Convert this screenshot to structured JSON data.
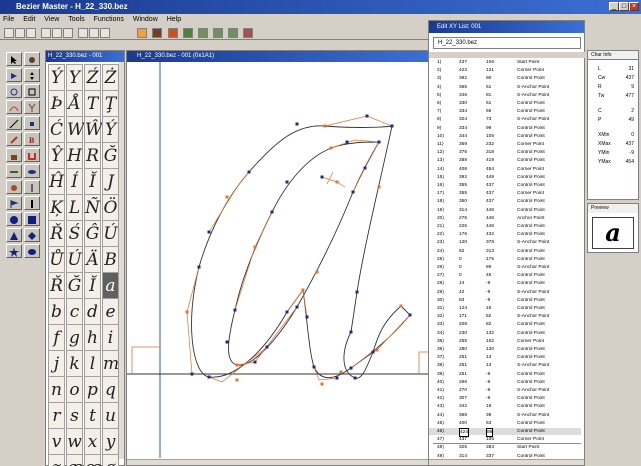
{
  "app": {
    "title": "Bezier Master - H_22_330.bez"
  },
  "menu": [
    "File",
    "Edit",
    "View",
    "Tools",
    "Functions",
    "Window",
    "Help"
  ],
  "glyph_window": {
    "title": "H_22_330.bez - 001"
  },
  "canvas_window": {
    "title": "H_22_330.bez - 001 (0x1A1)"
  },
  "glyphs": [
    "Ý",
    "Y",
    "Ź",
    "Ż",
    "Þ",
    "Å",
    "T",
    "Ţ",
    "Ć",
    "W",
    "Ŵ",
    "Ý",
    "Ŷ",
    "H",
    "R",
    "Ğ",
    "Ĥ",
    "Í",
    "Ĭ",
    "J",
    "Ķ",
    "L",
    "Ñ",
    "Ö",
    "Ř",
    "Ś",
    "Ĝ",
    "Ú",
    "Ů",
    "Ú",
    "Ä",
    "B",
    "Ř",
    "Ğ",
    "Ĭ",
    "a",
    "b",
    "c",
    "d",
    "e",
    "f",
    "g",
    "h",
    "i",
    "j",
    "k",
    "l",
    "m",
    "n",
    "o",
    "p",
    "q",
    "r",
    "s",
    "t",
    "u",
    "v",
    "w",
    "x",
    "y",
    "z",
    "æ",
    "œ",
    "ø"
  ],
  "point_list": {
    "title": "Edit XY List: 001",
    "file": "H_22_330.bez",
    "rows": [
      {
        "n": "1)",
        "x": "437",
        "y": "106",
        "t": "Start Point"
      },
      {
        "n": "2)",
        "x": "423",
        "y": "121",
        "t": "Corner Point"
      },
      {
        "n": "3)",
        "x": "392",
        "y": "90",
        "t": "Control Point"
      },
      {
        "n": "4)",
        "x": "365",
        "y": "61",
        "t": "S-Anchor Point"
      },
      {
        "n": "5)",
        "x": "346",
        "y": "81",
        "t": "S-Anchor Point"
      },
      {
        "n": "6)",
        "x": "330",
        "y": "61",
        "t": "Control Point"
      },
      {
        "n": "7)",
        "x": "334",
        "y": "66",
        "t": "Control Point"
      },
      {
        "n": "8)",
        "x": "324",
        "y": "73",
        "t": "S-Anchor Point"
      },
      {
        "n": "9)",
        "x": "334",
        "y": "99",
        "t": "Control Point"
      },
      {
        "n": "10)",
        "x": "344",
        "y": "105",
        "t": "Control Point"
      },
      {
        "n": "11)",
        "x": "359",
        "y": "232",
        "t": "Corner Point"
      },
      {
        "n": "12)",
        "x": "376",
        "y": "318",
        "t": "Control Point"
      },
      {
        "n": "13)",
        "x": "388",
        "y": "419",
        "t": "Control Point"
      },
      {
        "n": "14)",
        "x": "408",
        "y": "454",
        "t": "Corner Point"
      },
      {
        "n": "15)",
        "x": "392",
        "y": "449",
        "t": "Control Point"
      },
      {
        "n": "16)",
        "x": "355",
        "y": "437",
        "t": "Control Point"
      },
      {
        "n": "17)",
        "x": "355",
        "y": "437",
        "t": "Corner Point"
      },
      {
        "n": "18)",
        "x": "350",
        "y": "437",
        "t": "Control Point"
      },
      {
        "n": "19)",
        "x": "314",
        "y": "446",
        "t": "Control Point"
      },
      {
        "n": "20)",
        "x": "275",
        "y": "446",
        "t": "Anchor Point"
      },
      {
        "n": "21)",
        "x": "226",
        "y": "446",
        "t": "Control Point"
      },
      {
        "n": "22)",
        "x": "176",
        "y": "432",
        "t": "Control Point"
      },
      {
        "n": "23)",
        "x": "120",
        "y": "378",
        "t": "S-Anchor Point"
      },
      {
        "n": "24)",
        "x": "52",
        "y": "313",
        "t": "Control Point"
      },
      {
        "n": "25)",
        "x": "0",
        "y": "175",
        "t": "Control Point"
      },
      {
        "n": "26)",
        "x": "0",
        "y": "89",
        "t": "S-Anchor Point"
      },
      {
        "n": "27)",
        "x": "0",
        "y": "45",
        "t": "Control Point"
      },
      {
        "n": "28)",
        "x": "14",
        "y": "-9",
        "t": "Control Point"
      },
      {
        "n": "29)",
        "x": "42",
        "y": "-9",
        "t": "S-Anchor Point"
      },
      {
        "n": "30)",
        "x": "83",
        "y": "-9",
        "t": "Control Point"
      },
      {
        "n": "31)",
        "x": "124",
        "y": "16",
        "t": "Control Point"
      },
      {
        "n": "32)",
        "x": "171",
        "y": "52",
        "t": "S-Anchor Point"
      },
      {
        "n": "33)",
        "x": "208",
        "y": "82",
        "t": "Control Point"
      },
      {
        "n": "34)",
        "x": "230",
        "y": "132",
        "t": "Control Point"
      },
      {
        "n": "35)",
        "x": "255",
        "y": "152",
        "t": "Corner Point"
      },
      {
        "n": "36)",
        "x": "280",
        "y": "130",
        "t": "Control Point"
      },
      {
        "n": "37)",
        "x": "251",
        "y": "13",
        "t": "Control Point"
      },
      {
        "n": "38)",
        "x": "251",
        "y": "13",
        "t": "S-Anchor Point"
      },
      {
        "n": "39)",
        "x": "251",
        "y": "-9",
        "t": "Control Point"
      },
      {
        "n": "40)",
        "x": "266",
        "y": "-9",
        "t": "Control Point"
      },
      {
        "n": "41)",
        "x": "270",
        "y": "-9",
        "t": "S-Anchor Point"
      },
      {
        "n": "42)",
        "x": "307",
        "y": "-9",
        "t": "Control Point"
      },
      {
        "n": "43)",
        "x": "342",
        "y": "18",
        "t": "Control Point"
      },
      {
        "n": "44)",
        "x": "368",
        "y": "39",
        "t": "S-Anchor Point"
      },
      {
        "n": "45)",
        "x": "400",
        "y": "63",
        "t": "Control Point"
      },
      {
        "n": "46)",
        "x": "424",
        "y": "89",
        "t": "Control Point"
      },
      {
        "n": "47)",
        "x": "437",
        "y": "106",
        "t": "Corner Point"
      },
      {
        "n": "48)",
        "x": "325",
        "y": "383",
        "t": "Start Point"
      },
      {
        "n": "49)",
        "x": "314",
        "y": "337",
        "t": "Control Point"
      }
    ],
    "selected_index": 45
  },
  "char_info": {
    "title": "Char Info",
    "rows": [
      {
        "k": "L",
        "v": "31"
      },
      {
        "k": "Cw",
        "v": "437"
      },
      {
        "k": "R",
        "v": "9"
      },
      {
        "k": "Tw",
        "v": "477"
      },
      {
        "k": "C",
        "v": "2"
      },
      {
        "k": "P",
        "v": "49"
      },
      {
        "k": "XMin",
        "v": "0"
      },
      {
        "k": "XMax",
        "v": "437"
      },
      {
        "k": "YMin",
        "v": "-9"
      },
      {
        "k": "YMax",
        "v": "454"
      }
    ]
  },
  "preview": {
    "title": "Preview",
    "char": "a"
  },
  "colors": {
    "outline": "#333333",
    "handles": "#e8702a",
    "points": "#1c2a8c",
    "guide": "#3050c0"
  }
}
